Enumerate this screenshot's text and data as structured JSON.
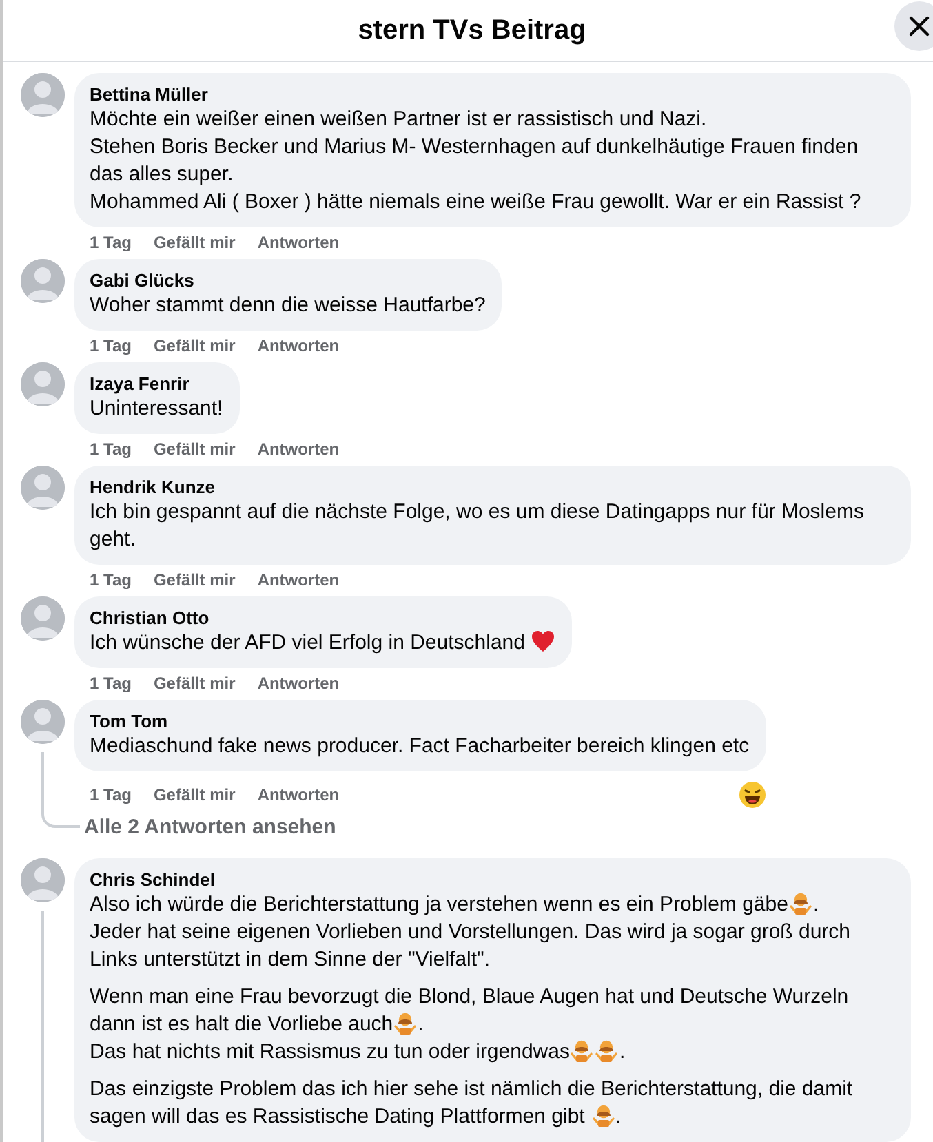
{
  "dialog": {
    "title": "stern TVs Beitrag"
  },
  "comments": [
    {
      "author": "Bettina Müller",
      "paragraphs": [
        [
          [
            "Möchte ein weißer einen weißen Partner ist er rassistisch und Nazi."
          ],
          [
            "Stehen Boris Becker und Marius M- Westernhagen auf dunkelhäutige Frauen finden das alles super."
          ],
          [
            "Mohammed Ali ( Boxer ) hätte niemals eine weiße Frau gewollt. War er ein Rassist ?"
          ]
        ]
      ],
      "time": "1 Tag",
      "like": "Gefällt mir",
      "reply": "Antworten",
      "thread": false
    },
    {
      "author": "Gabi Glücks",
      "paragraphs": [
        [
          [
            "Woher stammt denn die weisse Hautfarbe?"
          ]
        ]
      ],
      "time": "1 Tag",
      "like": "Gefällt mir",
      "reply": "Antworten",
      "thread": false
    },
    {
      "author": "Izaya Fenrir",
      "paragraphs": [
        [
          [
            "Uninteressant!"
          ]
        ]
      ],
      "time": "1 Tag",
      "like": "Gefällt mir",
      "reply": "Antworten",
      "thread": false
    },
    {
      "author": "Hendrik Kunze",
      "paragraphs": [
        [
          [
            "Ich bin gespannt auf die nächste Folge, wo es um diese Datingapps nur für Moslems geht."
          ]
        ]
      ],
      "time": "1 Tag",
      "like": "Gefällt mir",
      "reply": "Antworten",
      "thread": false
    },
    {
      "author": "Christian Otto",
      "paragraphs": [
        [
          [
            "Ich wünsche der AFD viel Erfolg in Deutschland ",
            {
              "kind": "heart"
            }
          ]
        ]
      ],
      "time": "1 Tag",
      "like": "Gefällt mir",
      "reply": "Antworten",
      "thread": false
    },
    {
      "author": "Tom Tom",
      "paragraphs": [
        [
          [
            "Mediaschund fake news producer. Fact Facharbeiter bereich klingen etc"
          ]
        ]
      ],
      "time": "1 Tag",
      "like": "Gefällt mir",
      "reply": "Antworten",
      "reaction": {
        "kind": "laugh"
      },
      "thread": true,
      "replies_link": "Alle 2 Antworten ansehen"
    },
    {
      "author": "Chris Schindel",
      "paragraphs": [
        [
          [
            "Also ich würde die Berichterstattung ja verstehen wenn es ein Problem gäbe",
            {
              "kind": "shrug"
            },
            "."
          ],
          [
            "Jeder hat seine eigenen Vorlieben und Vorstellungen. Das wird ja sogar groß durch Links unterstützt in dem Sinne der \"Vielfalt\"."
          ]
        ],
        [
          [
            "Wenn man eine Frau bevorzugt die Blond, Blaue Augen hat und Deutsche Wurzeln dann ist es halt die Vorliebe auch",
            {
              "kind": "shrug"
            },
            "."
          ],
          [
            "Das hat nichts mit Rassismus zu tun oder irgendwas",
            {
              "kind": "shrug"
            },
            {
              "kind": "shrug"
            },
            "."
          ]
        ],
        [
          [
            "Das einzigste Problem das ich hier sehe ist nämlich die Berichterstattung, die damit sagen will das es Rassistische Dating Plattformen gibt ",
            {
              "kind": "shrug"
            },
            "."
          ]
        ]
      ],
      "thread": true
    }
  ]
}
